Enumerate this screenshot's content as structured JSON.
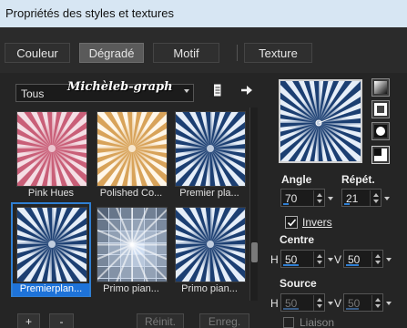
{
  "window": {
    "title": "Propriétés des styles et textures"
  },
  "tabs": [
    {
      "label": "Couleur",
      "active": false
    },
    {
      "label": "Dégradé",
      "active": true
    },
    {
      "label": "Motif",
      "active": false
    },
    {
      "label": "Texture",
      "active": false
    }
  ],
  "library": {
    "category": "Tous",
    "watermark": "Michèleb-graph",
    "folder_icon": "folder-list-icon",
    "arrow_icon": "arrow-right-icon"
  },
  "gradients": [
    {
      "caption": "Pink Hues",
      "style": "radial-pink"
    },
    {
      "caption": "Polished Co...",
      "style": "radial-gold"
    },
    {
      "caption": "Premier pla...",
      "style": "radial-blue"
    },
    {
      "caption": "Premierplan...",
      "style": "radial-blue",
      "selected": true
    },
    {
      "caption": "Primo pian...",
      "style": "grid-blue"
    },
    {
      "caption": "Primo pian...",
      "style": "radial-blue"
    }
  ],
  "style_buttons": [
    "linear-style-icon",
    "rectangular-style-icon",
    "sunburst-style-icon",
    "radial-style-icon"
  ],
  "params": {
    "angle_label": "Angle",
    "angle_value": "70",
    "angle_fill": 0.19,
    "repeat_label": "Répét.",
    "repeat_value": "21",
    "repeat_fill": 0.21,
    "invert_label": "Invers",
    "invert_checked": true,
    "center_label": "Centre",
    "center_h_label": "H",
    "center_h_value": "50",
    "center_h_fill": 0.5,
    "center_v_label": "V",
    "center_v_value": "50",
    "center_v_fill": 0.5,
    "source_label": "Source",
    "source_h_label": "H",
    "source_h_value": "50",
    "source_h_fill": 0.5,
    "source_v_label": "V",
    "source_v_value": "50",
    "source_v_fill": 0.5,
    "link_label": "Liaison"
  },
  "bottom": {
    "add_label": "+",
    "remove_label": "-",
    "reset_label": "Réinit.",
    "save_label": "Enreg."
  },
  "colors": {
    "accent": "#2f7fd3",
    "selection": "#1e73d9",
    "gradient_dark": "#1c3f72",
    "gradient_light": "#e6eef8",
    "pink": "#c95f78",
    "gold": "#d8a35a"
  }
}
